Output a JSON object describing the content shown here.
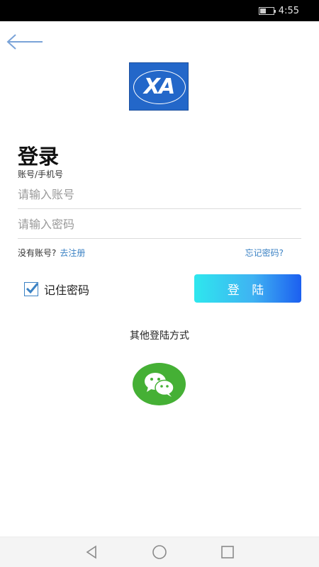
{
  "status_bar": {
    "time": "4:55",
    "battery_icon": "battery-icon",
    "battery_level": 0.45
  },
  "header": {
    "back_icon": "arrow-left-icon",
    "logo_text": "XA"
  },
  "login": {
    "title": "登录",
    "account_caption": "账号/手机号",
    "account_placeholder": "请输入账号",
    "account_value": "",
    "password_placeholder": "请输入密码",
    "password_value": "",
    "no_account_text": "没有账号?",
    "register_link": "去注册",
    "forgot_link": "忘记密码?",
    "remember_label": "记住密码",
    "remember_checked": true,
    "login_button": "登 陆",
    "other_methods": "其他登陆方式",
    "wechat_icon": "wechat-icon"
  },
  "nav_bar": {
    "back_icon": "nav-back-icon",
    "home_icon": "nav-home-icon",
    "recents_icon": "nav-recents-icon"
  },
  "colors": {
    "accent": "#3b82c4",
    "button_gradient_start": "#2ee7ee",
    "button_gradient_end": "#1c5ff0",
    "wechat_green": "#45b035",
    "logo_blue": "#2367c9"
  }
}
